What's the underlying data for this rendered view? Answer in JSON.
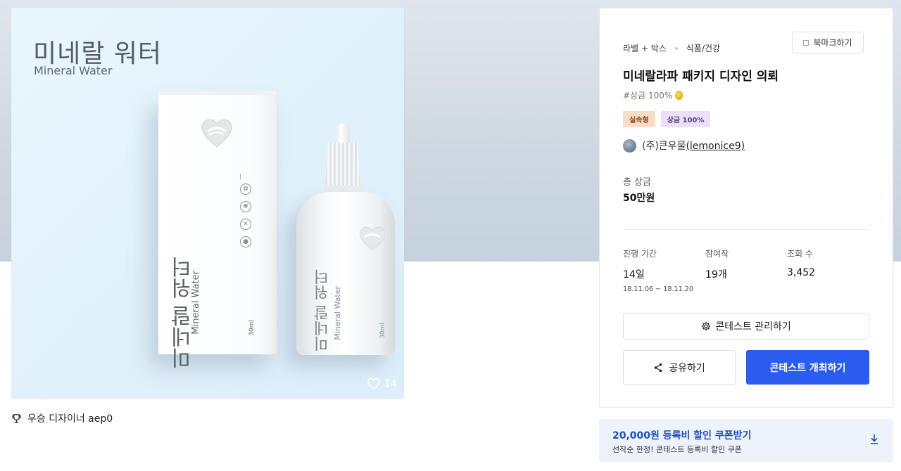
{
  "product_image": {
    "title": "미네랄 워터",
    "subtitle": "Mineral Water",
    "box_name_ko": "미네랄 워터",
    "box_name_en": "Mineral Water",
    "box_volume": "30ml",
    "bottle_name_ko": "미네랄 워터",
    "bottle_name_en": "Mineral Water",
    "bottle_volume": "30ml",
    "like_count": "14"
  },
  "winner": {
    "label": "우승 디자이너 aep0"
  },
  "contest": {
    "category_1": "라벨 + 박스",
    "category_2": "식품/건강",
    "bookmark_label": "북마크하기",
    "title": "미네랄라파 패키지 디자인 의뢰",
    "hashtag": "#상금 100%",
    "badges": [
      "실속형",
      "상금 100%"
    ],
    "host_name": "(주)큰우물",
    "host_handle": "(lemonice9)",
    "prize_label": "총 상금",
    "prize_value": "50만원",
    "stats": {
      "period_label": "진행 기간",
      "period_value": "14일",
      "period_dates": "18.11.06 ~ 18.11.20",
      "entries_label": "참여작",
      "entries_value": "19개",
      "views_label": "조회 수",
      "views_value": "3,452"
    },
    "manage_label": "콘테스트 관리하기",
    "share_label": "공유하기",
    "host_label": "콘테스트 개최하기"
  },
  "coupon": {
    "title": "20,000원 등록비 할인 쿠폰받기",
    "subtitle": "선착순 한정! 콘테스트 등록비 할인 쿠폰"
  },
  "colors": {
    "primary_button": "#2a5cf0",
    "coupon_title": "#1d4fc4",
    "badge_1_bg": "#f7dcc8",
    "badge_2_bg": "#ece0f8"
  },
  "icons": [
    "heart-icon",
    "trophy-icon",
    "bookmark-icon",
    "coin-icon",
    "gear-icon",
    "share-icon",
    "download-icon"
  ]
}
